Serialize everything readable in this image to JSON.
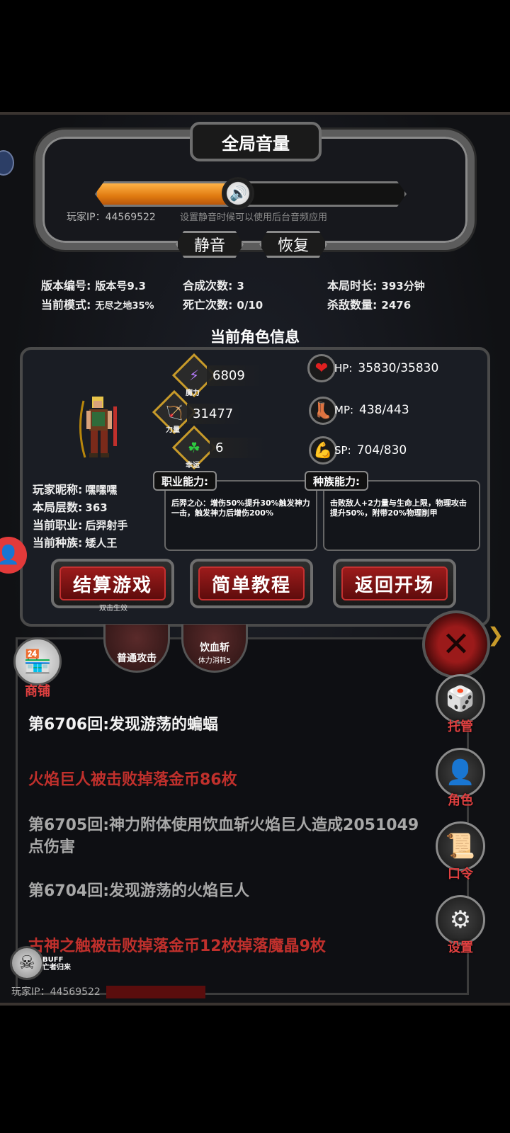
{
  "volume_panel": {
    "title": "全局音量",
    "level": 0.46,
    "player_ip": "玩家IP：44569522",
    "hint": "设置静音时候可以使用后台音频应用",
    "mute_label": "静音",
    "restore_label": "恢复"
  },
  "stats": {
    "version_key": "版本编号:",
    "version_val": "版本号9.3",
    "mode_key": "当前模式:",
    "mode_val": "无尽之地35%",
    "synth_key": "合成次数:",
    "synth_val": "3",
    "death_key": "死亡次数:",
    "death_val": "0/10",
    "duration_key": "本局时长:",
    "duration_val": "393分钟",
    "kills_key": "杀敌数量:",
    "kills_val": "2476"
  },
  "character": {
    "section_title": "当前角色信息",
    "magic": {
      "caption": "魔力",
      "value": "6809"
    },
    "strength": {
      "caption": "力量",
      "value": "31477"
    },
    "luck": {
      "caption": "幸运",
      "value": "6"
    },
    "hp": {
      "label": "HP:",
      "value": "35830/35830"
    },
    "mp": {
      "label": "MP:",
      "value": "438/443"
    },
    "sp": {
      "label": "SP:",
      "value": "704/830"
    },
    "nickname_key": "玩家昵称:",
    "nickname_val": "嘿嘿嘿",
    "floor_key": "本局层数:",
    "floor_val": "363",
    "job_key": "当前职业:",
    "job_val": "后羿射手",
    "race_key": "当前种族:",
    "race_val": "矮人王",
    "job_ability_title": "职业能力:",
    "job_ability_text": "后羿之心：增伤50%提升30%触发神力一击，触发神力后增伤200%",
    "race_ability_title": "种族能力:",
    "race_ability_text": "击败敌人+2力量与生命上限，物理攻击提升50%，附带20%物理削甲"
  },
  "actions": {
    "settle_label": "结算游戏",
    "settle_sub": "双击生效",
    "tutorial_label": "简单教程",
    "return_label": "返回开场"
  },
  "skills": {
    "normal_attack": "普通攻击",
    "blood_slash": "饮血斩",
    "blood_slash_cost": "体力消耗5"
  },
  "side_menu": {
    "shop": "商铺",
    "auto": "托管",
    "role": "角色",
    "code": "口令",
    "settings": "设置"
  },
  "log": [
    {
      "text": "第6706回:发现游荡的蝙蝠",
      "color": "#f2f2f2"
    },
    {
      "text": "火焰巨人被击败掉落金币86枚",
      "color": "#c0302c"
    },
    {
      "text": "第6705回:神力附体使用饮血斩火焰巨人造成2051049点伤害",
      "color": "#a8a8a8"
    },
    {
      "text": "第6704回:发现游荡的火焰巨人",
      "color": "#a8a8a8"
    },
    {
      "text": "古神之触被击败掉落金币12枚掉落魔晶9枚",
      "color": "#c0302c"
    }
  ],
  "buff": {
    "title": "BUFF",
    "name": "亡者归来"
  },
  "footer_ip": "玩家IP：44569522",
  "colors": {
    "accent_red": "#c0302c",
    "gold": "#c89b2a",
    "volume_fill": "#e07a10"
  }
}
